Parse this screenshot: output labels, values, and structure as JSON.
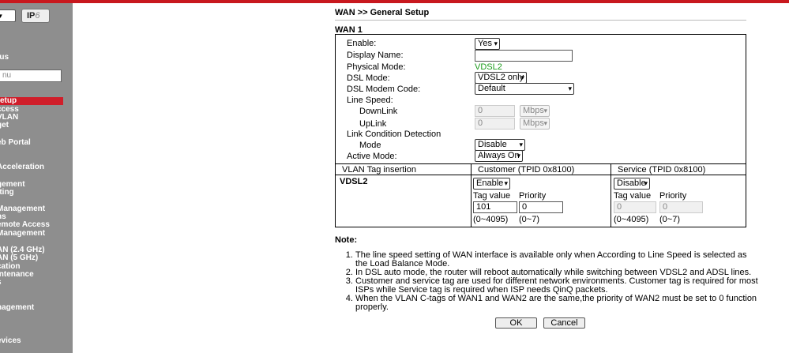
{
  "sidebar": {
    "logout": "ut",
    "ipv6": "IP",
    "ipv6_suffix": "6",
    "search_placeholder": "nu",
    "items": [
      "l",
      "tus",
      "etup",
      "ccess",
      "VLAN",
      "get",
      "eb Portal",
      "Acceleration",
      "gement",
      "tting",
      "Management",
      "ns",
      "emote Access",
      "Management",
      "AN (2.4 GHz)",
      "AN (5 GHz)",
      "cation",
      "intenance",
      "s",
      "nagement",
      "evices"
    ]
  },
  "page": {
    "title": "WAN >> General Setup",
    "section": "WAN 1"
  },
  "form": {
    "enable_label": "Enable:",
    "enable_value": "Yes",
    "display_name_label": "Display Name:",
    "display_name_value": "",
    "physical_mode_label": "Physical Mode:",
    "physical_mode_value": "VDSL2",
    "dsl_mode_label": "DSL Mode:",
    "dsl_mode_value": "VDSL2 only",
    "dsl_modem_code_label": "DSL Modem Code:",
    "dsl_modem_code_value": "Default",
    "line_speed_label": "Line Speed:",
    "downlink_label": "DownLink",
    "downlink_value": "0",
    "downlink_unit": "Mbps",
    "uplink_label": "UpLink",
    "uplink_value": "0",
    "uplink_unit": "Mbps",
    "lcd_label": "Link Condition Detection",
    "mode_label": "Mode",
    "mode_value": "Disable",
    "active_mode_label": "Active Mode:",
    "active_mode_value": "Always On"
  },
  "vlan": {
    "header_col1": "VLAN Tag insertion",
    "header_col2": "Customer (TPID 0x8100)",
    "header_col3": "Service (TPID 0x8100)",
    "row_label": "VDSL2",
    "customer": {
      "select": "Enable",
      "tag_label": "Tag value",
      "priority_label": "Priority",
      "tag_value": "101",
      "priority_value": "0",
      "tag_range": "(0~4095)",
      "priority_range": "(0~7)"
    },
    "service": {
      "select": "Disable",
      "tag_label": "Tag value",
      "priority_label": "Priority",
      "tag_value": "0",
      "priority_value": "0",
      "tag_range": "(0~4095)",
      "priority_range": "(0~7)"
    }
  },
  "notes": {
    "title": "Note:",
    "items": [
      "The line speed setting of WAN interface is available only when According to Line Speed is selected as the Load Balance Mode.",
      "In DSL auto mode, the router will reboot automatically while switching between VDSL2 and ADSL lines.",
      "Customer and service tag are used for different network environments. Customer tag is required for most ISPs while Service tag is required when ISP needs QinQ packets.",
      "When the VLAN C-tags of WAN1 and WAN2 are the same,the priority of WAN2 must be set to 0 function properly."
    ]
  },
  "buttons": {
    "ok": "OK",
    "cancel": "Cancel"
  }
}
